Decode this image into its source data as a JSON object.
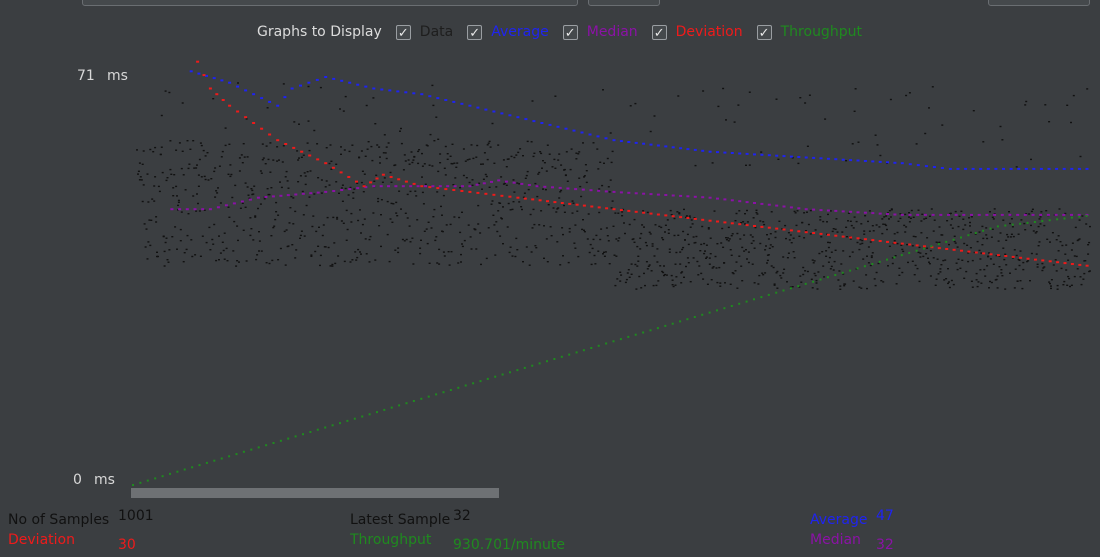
{
  "legend": {
    "title": "Graphs to Display",
    "items": [
      {
        "label": "Data",
        "color": "#1e1e1e",
        "checked": true
      },
      {
        "label": "Average",
        "color": "#1f24f0",
        "checked": true
      },
      {
        "label": "Median",
        "color": "#8b12a6",
        "checked": true
      },
      {
        "label": "Deviation",
        "color": "#ee1b1b",
        "checked": true
      },
      {
        "label": "Throughput",
        "color": "#1f8a1f",
        "checked": true
      }
    ]
  },
  "axis": {
    "max_label": "71",
    "min_label": "0",
    "unit": "ms"
  },
  "stats": {
    "samples_label": "No of Samples",
    "samples_value": "1001",
    "latest_label": "Latest Sample",
    "latest_value": "32",
    "average_label": "Average",
    "average_value": "47",
    "deviation_label": "Deviation",
    "deviation_value": "30",
    "throughput_label": "Throughput",
    "throughput_value": "930.701/minute",
    "median_label": "Median",
    "median_value": "32"
  },
  "chart_data": {
    "type": "scatter",
    "ylim": [
      0,
      71
    ],
    "y_unit": "ms",
    "samples": 1001,
    "series": [
      {
        "name": "Average",
        "color": "#1f24f0",
        "points": [
          [
            60,
            72
          ],
          [
            100,
            70
          ],
          [
            150,
            66
          ],
          [
            165,
            69
          ],
          [
            200,
            71
          ],
          [
            250,
            69
          ],
          [
            300,
            68
          ],
          [
            350,
            66
          ],
          [
            400,
            64
          ],
          [
            450,
            62
          ],
          [
            500,
            60
          ],
          [
            600,
            58
          ],
          [
            700,
            57
          ],
          [
            800,
            56
          ],
          [
            850,
            55
          ],
          [
            1000,
            55
          ]
        ]
      },
      {
        "name": "Median",
        "color": "#8b12a6",
        "points": [
          [
            40,
            48
          ],
          [
            80,
            48
          ],
          [
            130,
            50
          ],
          [
            200,
            51
          ],
          [
            250,
            52
          ],
          [
            350,
            52
          ],
          [
            380,
            53
          ],
          [
            420,
            52
          ],
          [
            500,
            51
          ],
          [
            600,
            50
          ],
          [
            700,
            48
          ],
          [
            800,
            47
          ],
          [
            1000,
            47
          ]
        ]
      },
      {
        "name": "Deviation",
        "color": "#ee1b1b",
        "points": [
          [
            60,
            76
          ],
          [
            80,
            69
          ],
          [
            100,
            66
          ],
          [
            150,
            60
          ],
          [
            200,
            56
          ],
          [
            240,
            52
          ],
          [
            260,
            54
          ],
          [
            300,
            52
          ],
          [
            350,
            51
          ],
          [
            400,
            50
          ],
          [
            500,
            48
          ],
          [
            600,
            46
          ],
          [
            700,
            44
          ],
          [
            800,
            42
          ],
          [
            900,
            40
          ],
          [
            1000,
            38
          ]
        ]
      },
      {
        "name": "Throughput",
        "color": "#1f8a1f",
        "points": [
          [
            0,
            0
          ],
          [
            100,
            5
          ],
          [
            200,
            10
          ],
          [
            300,
            15
          ],
          [
            400,
            20
          ],
          [
            500,
            25
          ],
          [
            600,
            30
          ],
          [
            700,
            35
          ],
          [
            800,
            40
          ],
          [
            900,
            45
          ],
          [
            1000,
            47
          ]
        ]
      }
    ]
  }
}
